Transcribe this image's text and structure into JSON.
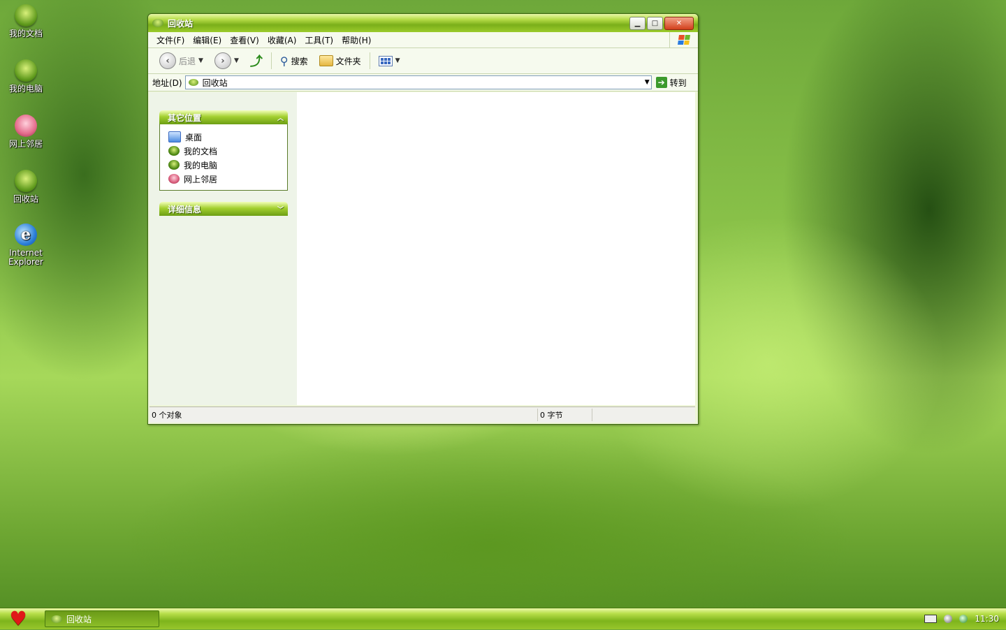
{
  "desktop": {
    "icons": [
      {
        "label": "我的文档",
        "icon": "my-documents-icon"
      },
      {
        "label": "我的电脑",
        "icon": "my-computer-icon"
      },
      {
        "label": "网上邻居",
        "icon": "network-places-icon"
      },
      {
        "label": "回收站",
        "icon": "recycle-bin-icon"
      },
      {
        "label_line1": "Internet",
        "label_line2": "Explorer",
        "icon": "internet-explorer-icon"
      }
    ]
  },
  "window": {
    "title": "回收站",
    "menu": [
      "文件(F)",
      "编辑(E)",
      "查看(V)",
      "收藏(A)",
      "工具(T)",
      "帮助(H)"
    ],
    "toolbar": {
      "back_label": "后退",
      "search_label": "搜索",
      "folders_label": "文件夹"
    },
    "address": {
      "label": "地址(D)",
      "value": "回收站",
      "go_label": "转到"
    },
    "taskpane": {
      "other_places": {
        "title": "其它位置",
        "items": [
          "桌面",
          "我的文档",
          "我的电脑",
          "网上邻居"
        ]
      },
      "details": {
        "title": "详细信息"
      }
    },
    "status": {
      "objects": "0 个对象",
      "size": "0 字节"
    }
  },
  "taskbar": {
    "active_task": "回收站",
    "clock": "11:30"
  },
  "colors": {
    "accent_green": "#7aaf1a",
    "close_red": "#d2401c",
    "start_heart": "#e01818"
  }
}
